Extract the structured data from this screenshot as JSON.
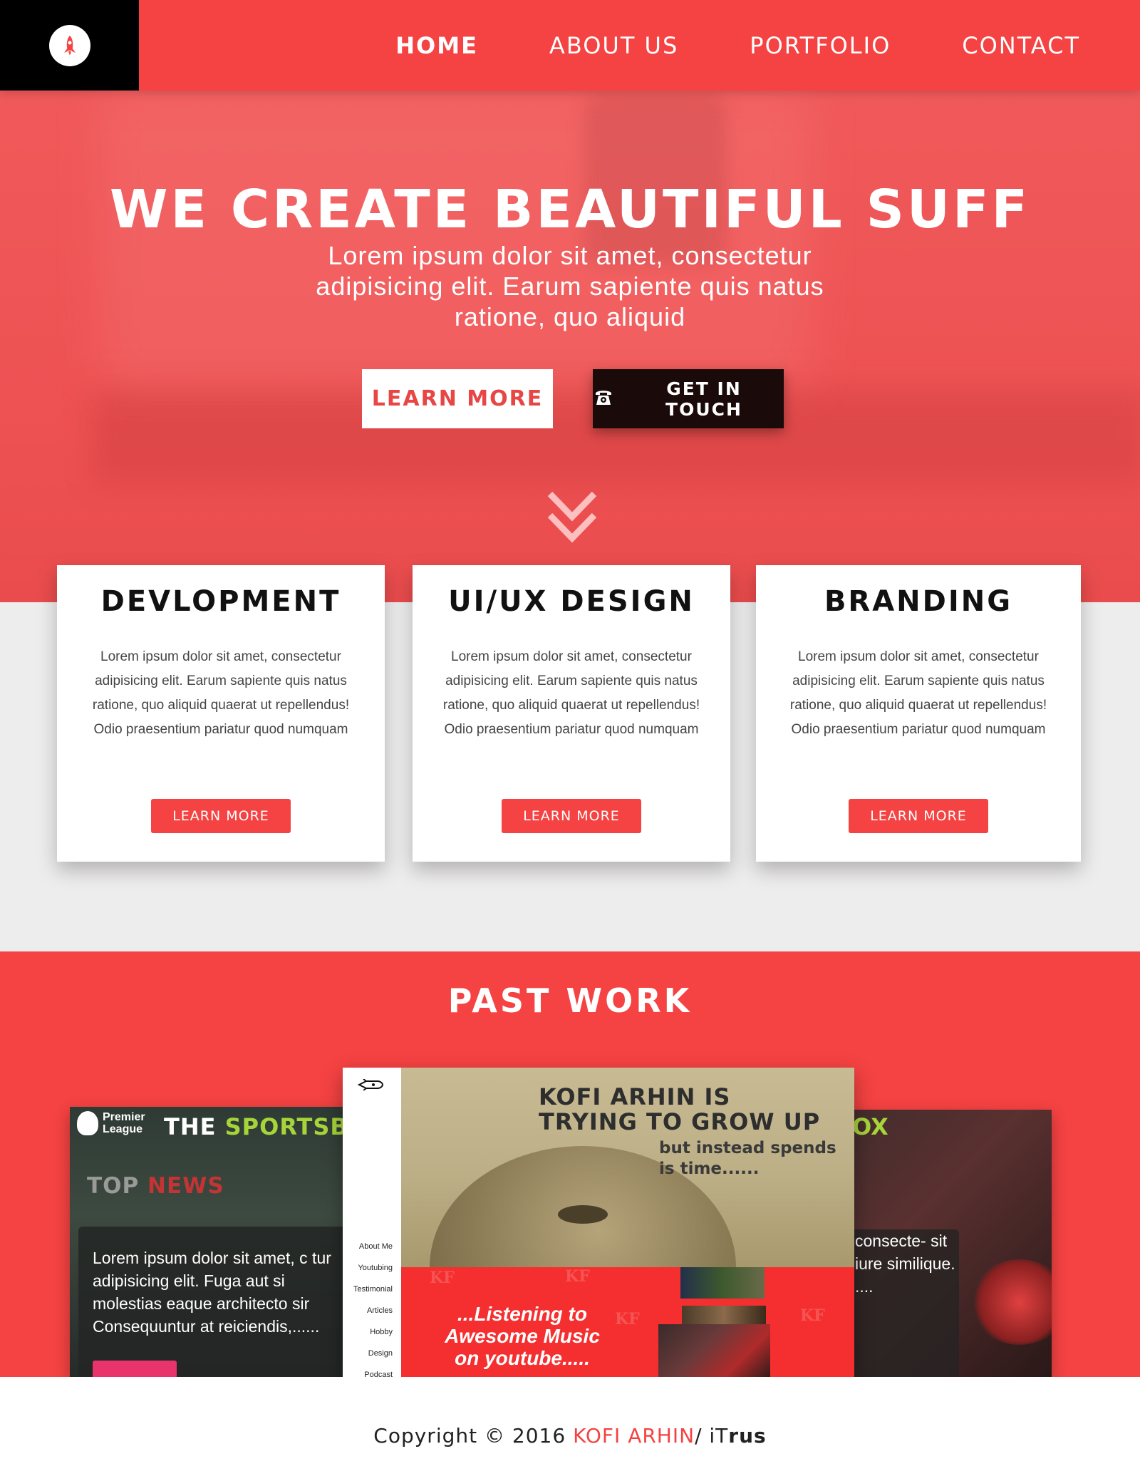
{
  "nav": {
    "links": [
      "HOME",
      "ABOUT US",
      "PORTFOLIO",
      "CONTACT"
    ],
    "active": "HOME",
    "logo_icon": "rocket-icon"
  },
  "hero": {
    "title": "WE CREATE BEAUTIFUL SUFF",
    "subtitle": "Lorem ipsum dolor sit amet, consectetur adipisicing elit. Earum sapiente quis natus ratione, quo aliquid",
    "learn_more": "LEARN MORE",
    "get_in_touch": "GET IN TOUCH",
    "phone_icon": "phone-icon",
    "scroll_icon": "double-chevron-down-icon"
  },
  "services": [
    {
      "title": "DEVLOPMENT",
      "text": "Lorem ipsum dolor sit amet, consectetur adipisicing elit. Earum sapiente quis natus ratione, quo aliquid quaerat ut repellendus! Odio praesentium pariatur quod numquam",
      "button": "LEARN MORE"
    },
    {
      "title": "UI/UX DESIGN",
      "text": "Lorem ipsum dolor sit amet, consectetur adipisicing elit. Earum sapiente quis natus ratione, quo aliquid quaerat ut repellendus! Odio praesentium pariatur quod numquam",
      "button": "LEARN MORE"
    },
    {
      "title": "BRANDING",
      "text": "Lorem ipsum dolor sit amet, consectetur adipisicing elit. Earum sapiente quis natus ratione, quo aliquid quaerat ut repellendus! Odio praesentium pariatur quod numquam",
      "button": "LEARN MORE"
    }
  ],
  "past_work": {
    "title": "PAST WORK",
    "left": {
      "logo_line1": "Premier",
      "logo_line2": "League",
      "site_title_a": "THE ",
      "site_title_b": "SPORTSBO",
      "top_a": "TOP ",
      "top_b": "NEWS",
      "text": "Lorem ipsum dolor sit amet, c tur adipisicing elit. Fuga aut si molestias eaque architecto sir Consequuntur at reiciendis,......"
    },
    "center": {
      "menu": [
        "About Me",
        "Youtubing",
        "Testimonial",
        "Articles",
        "Hobby",
        "Design",
        "Podcast"
      ],
      "headline_line1": "KOFI ARHIN IS",
      "headline_line2": "TRYING TO GROW UP",
      "sub_line1": "but instead spends",
      "sub_line2": "is time......",
      "listen_line1": "...Listening to",
      "listen_line2": "Awesome Music",
      "listen_line3": "on youtube....."
    },
    "right": {
      "site_title": "OX",
      "text": "consecte- sit iure similique. ...."
    }
  },
  "footer": {
    "prefix": "Copyright © 2016 ",
    "name": "KOFI ARHIN",
    "sep": "/ iT",
    "suffix": "rus"
  },
  "colors": {
    "brand_red": "#f54242",
    "dark": "#1a0a0a",
    "accent_green": "#a6d43a"
  }
}
